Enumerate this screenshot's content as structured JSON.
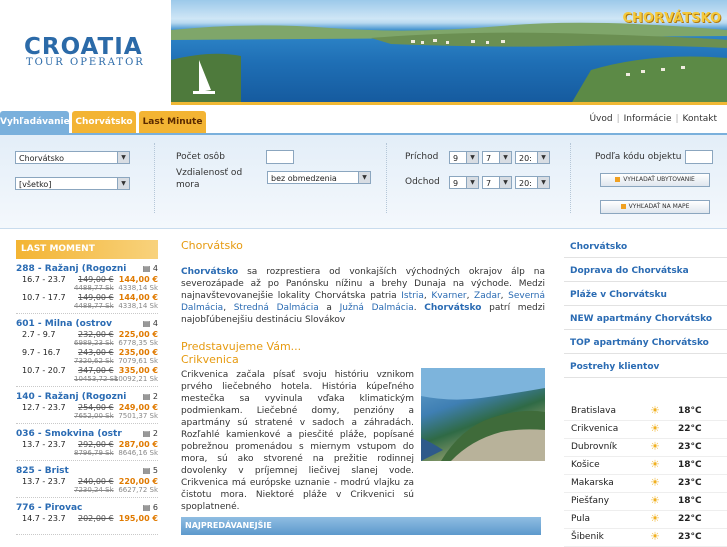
{
  "logo": {
    "line1": "CROATIA",
    "line2": "TOUR OPERATOR"
  },
  "banner": {
    "badge": "CHORVÁTSKO"
  },
  "tabs": [
    "Vyhľadávanie",
    "Chorvátsko",
    "Last Minute"
  ],
  "toplinks": [
    "Úvod",
    "Informácie",
    "Kontakt"
  ],
  "search": {
    "country": "Chorvátsko",
    "region": "[všetko]",
    "persons_label": "Počet osôb",
    "distance_label": "Vzdialenosť od mora",
    "distance_value": "bez obmedzenia",
    "arrival_label": "Príchod",
    "departure_label": "Odchod",
    "arrival": {
      "day": "9",
      "month": "7",
      "year": "20:"
    },
    "departure": {
      "day": "9",
      "month": "7",
      "year": "20:"
    },
    "code_label": "Podľa kódu objektu",
    "btn_search": "VYHĽADAŤ UBYTOVANIE",
    "btn_map": "VYHĽADAŤ NA MAPE"
  },
  "lastmoment": {
    "title": "LAST MOMENT",
    "deals": [
      {
        "title": "288 - Ražanj (Rogozni",
        "persons": "4",
        "rows": [
          {
            "dates": "16.7 - 23.7",
            "old": "149,00 €",
            "new": "144,00 €",
            "old_sk": "4488,77 Sk",
            "new_sk": "4338,14 Sk"
          },
          {
            "dates": "10.7 - 17.7",
            "old": "149,00 €",
            "new": "144,00 €",
            "old_sk": "4488,77 Sk",
            "new_sk": "4338,14 Sk"
          }
        ]
      },
      {
        "title": "601 - Milna (ostrov",
        "persons": "4",
        "rows": [
          {
            "dates": "2.7 - 9.7",
            "old": "232,00 €",
            "new": "225,00 €",
            "old_sk": "6989,23 Sk",
            "new_sk": "6778,35 Sk"
          },
          {
            "dates": "9.7 - 16.7",
            "old": "243,00 €",
            "new": "235,00 €",
            "old_sk": "7320,62 Sk",
            "new_sk": "7079,61 Sk"
          },
          {
            "dates": "10.7 - 20.7",
            "old": "347,00 €",
            "new": "335,00 €",
            "old_sk": "10453,72 Sk",
            "new_sk": "10092,21 Sk"
          }
        ]
      },
      {
        "title": "140 - Ražanj (Rogozni",
        "persons": "2",
        "rows": [
          {
            "dates": "12.7 - 23.7",
            "old": "254,00 €",
            "new": "249,00 €",
            "old_sk": "7652,00 Sk",
            "new_sk": "7501,37 Sk"
          }
        ]
      },
      {
        "title": "036 - Smokvina (ostr",
        "persons": "2",
        "rows": [
          {
            "dates": "13.7 - 23.7",
            "old": "292,00 €",
            "new": "287,00 €",
            "old_sk": "8796,79 Sk",
            "new_sk": "8646,16 Sk"
          }
        ]
      },
      {
        "title": "825 - Brist",
        "persons": "5",
        "rows": [
          {
            "dates": "13.7 - 23.7",
            "old": "240,00 €",
            "new": "220,00 €",
            "old_sk": "7230,24 Sk",
            "new_sk": "6627,72 Sk"
          }
        ]
      },
      {
        "title": "776 - Pirovac",
        "persons": "6",
        "rows": [
          {
            "dates": "14.7 - 23.7",
            "old": "202,00 €",
            "new": "195,00 €",
            "old_sk": "",
            "new_sk": ""
          }
        ]
      }
    ]
  },
  "main": {
    "title": "Chorvátsko",
    "intro_b1": "Chorvátsko",
    "intro_p1": " sa rozprestiera od vonkajších východných okrajov álp na severozápade až po Panónsku nížinu a brehy Dunaja na východe. Medzi najnavštevovanejšie lokality Chorvátska patria ",
    "regions": [
      "Istria",
      "Kvarner",
      "Zadar",
      "Severná Dalmácia",
      "Stredná Dalmácia",
      "Južná Dalmácia"
    ],
    "intro_b2": "Chorvátsko",
    "intro_p2": " patrí medzi najobľúbenejšiu destináciu Slovákov",
    "pred": "Predstavujeme Vám...",
    "crik_title": "Crikvenica",
    "crik_text": "Crikvenica začala písať svoju históriu vznikom prvého liečebného hotela. História kúpeľného mestečka sa vyvinula vďaka klimatickým podmienkam. Liečebné domy, penzióny a apartmány sú stratené v sadoch a záhradách. Rozľahlé kamienkové a piesčité pláže, popísané pobrežnou promenádou s miernym vstupom do mora, sú ako stvorené na prežitie rodinnej dovolenky v príjemnej liečivej slanej vode. Crikvenica má európske uznanie - modrú vlajku za čistotu mora. Niektoré pláže v Crikvenici sú spoplatnené.",
    "bestsellers": "NAJPREDÁVANEJŠIE"
  },
  "right": {
    "links": [
      "Chorvátsko",
      "Doprava do Chorvátska",
      "Pláže v Chorvátsku",
      "NEW apartmány Chorvátsko",
      "TOP apartmány Chorvátsko",
      "Postrehy klientov"
    ],
    "weather": [
      {
        "city": "Bratislava",
        "temp": "18°C"
      },
      {
        "city": "Crikvenica",
        "temp": "22°C"
      },
      {
        "city": "Dubrovník",
        "temp": "23°C"
      },
      {
        "city": "Košice",
        "temp": "18°C"
      },
      {
        "city": "Makarska",
        "temp": "23°C"
      },
      {
        "city": "Piešťany",
        "temp": "18°C"
      },
      {
        "city": "Pula",
        "temp": "22°C"
      },
      {
        "city": "Šibenik",
        "temp": "23°C"
      }
    ]
  }
}
